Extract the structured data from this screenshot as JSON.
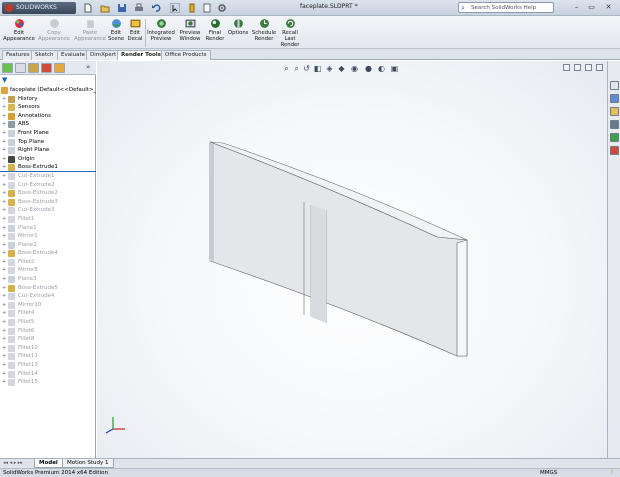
{
  "titlebar": {
    "logo": "SOLIDWORKS",
    "doc_title": "faceplate.SLDPRT *",
    "search_placeholder": "Search SolidWorks Help",
    "min": "–",
    "max": "▭",
    "close": "✕"
  },
  "commands": [
    {
      "label": "Edit Appearance",
      "dim": false
    },
    {
      "label": "Copy Appearance",
      "dim": true
    },
    {
      "label": "Paste Appearance",
      "dim": true
    },
    {
      "label": "Edit Scene",
      "dim": false
    },
    {
      "label": "Edit Decal",
      "dim": false
    },
    {
      "label": "Integrated Preview",
      "dim": false
    },
    {
      "label": "Preview Window",
      "dim": false
    },
    {
      "label": "Final Render",
      "dim": false
    },
    {
      "label": "Options",
      "dim": false
    },
    {
      "label": "Schedule Render",
      "dim": false
    },
    {
      "label": "Recall Last Render",
      "dim": false
    }
  ],
  "tabs": [
    "Features",
    "Sketch",
    "Evaluate",
    "DimXpert",
    "Render Tools",
    "Office Products"
  ],
  "active_tab": "Render Tools",
  "tree": [
    {
      "label": "faceplate  (Default<<Default>_D",
      "icon": "part-icon",
      "root": true,
      "dim": false
    },
    {
      "label": "History",
      "icon": "history-icon",
      "dim": false
    },
    {
      "label": "Sensors",
      "icon": "sensor-icon",
      "dim": false
    },
    {
      "label": "Annotations",
      "icon": "annotation-icon",
      "dim": false
    },
    {
      "label": "ABS",
      "icon": "material-icon",
      "dim": false
    },
    {
      "label": "Front Plane",
      "icon": "plane-icon",
      "dim": false
    },
    {
      "label": "Top Plane",
      "icon": "plane-icon",
      "dim": false
    },
    {
      "label": "Right Plane",
      "icon": "plane-icon",
      "dim": false
    },
    {
      "label": "Origin",
      "icon": "origin-icon",
      "dim": false
    },
    {
      "label": "Boss-Extrude1",
      "icon": "extrude-icon",
      "dim": false,
      "rollback": true
    },
    {
      "label": "Cut-Extrude1",
      "icon": "cut-icon",
      "dim": true
    },
    {
      "label": "Cut-Extrude2",
      "icon": "cut-icon",
      "dim": true
    },
    {
      "label": "Boss-Extrude2",
      "icon": "extrude-icon",
      "dim": true
    },
    {
      "label": "Boss-Extrude3",
      "icon": "extrude-icon",
      "dim": true
    },
    {
      "label": "Cut-Extrude3",
      "icon": "cut-icon",
      "dim": true
    },
    {
      "label": "Fillet1",
      "icon": "fillet-icon",
      "dim": true
    },
    {
      "label": "Plane1",
      "icon": "plane-icon",
      "dim": true
    },
    {
      "label": "Mirror1",
      "icon": "mirror-icon",
      "dim": true
    },
    {
      "label": "Plane2",
      "icon": "plane-icon",
      "dim": true
    },
    {
      "label": "Boss-Extrude4",
      "icon": "extrude-icon",
      "dim": true
    },
    {
      "label": "Fillet2",
      "icon": "fillet-icon",
      "dim": true
    },
    {
      "label": "Mirror8",
      "icon": "mirror-icon",
      "dim": true
    },
    {
      "label": "Plane3",
      "icon": "plane-icon",
      "dim": true
    },
    {
      "label": "Boss-Extrude5",
      "icon": "extrude-icon",
      "dim": true
    },
    {
      "label": "Cut-Extrude4",
      "icon": "cut-icon",
      "dim": true
    },
    {
      "label": "Mirror10",
      "icon": "mirror-icon",
      "dim": true
    },
    {
      "label": "Fillet4",
      "icon": "fillet-icon",
      "dim": true
    },
    {
      "label": "Fillet5",
      "icon": "fillet-icon",
      "dim": true
    },
    {
      "label": "Fillet6",
      "icon": "fillet-icon",
      "dim": true
    },
    {
      "label": "Fillet8",
      "icon": "fillet-icon",
      "dim": true
    },
    {
      "label": "Fillet10",
      "icon": "fillet-icon",
      "dim": true
    },
    {
      "label": "Fillet11",
      "icon": "fillet-icon",
      "dim": true
    },
    {
      "label": "Fillet13",
      "icon": "fillet-icon",
      "dim": true
    },
    {
      "label": "Fillet14",
      "icon": "fillet-icon",
      "dim": true
    },
    {
      "label": "Fillet15",
      "icon": "fillet-icon",
      "dim": true
    }
  ],
  "bottom_tabs": [
    "Model",
    "Motion Study 1"
  ],
  "active_bottom_tab": "Model",
  "status": {
    "left": "SolidWorks Premium 2014 x64 Edition",
    "units": "MMGS"
  },
  "colors": {
    "accent": "#2c62b8",
    "part_face": "#e4e6ea"
  }
}
